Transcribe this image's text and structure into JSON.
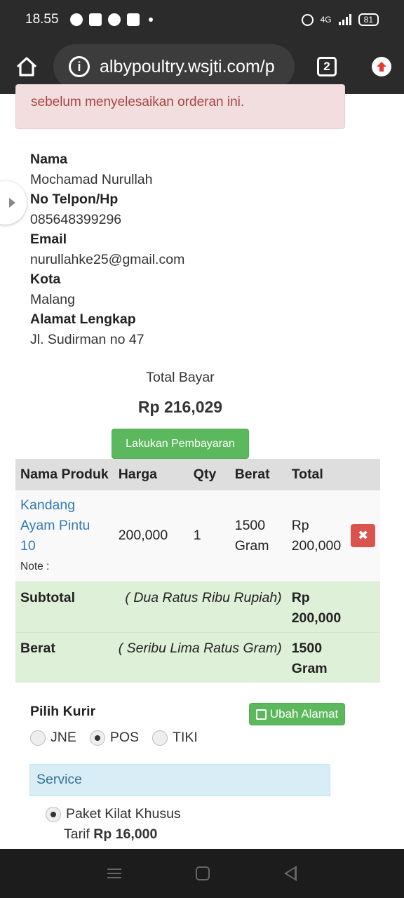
{
  "statusbar": {
    "time": "18.55",
    "network": "4G",
    "battery": "81"
  },
  "browser": {
    "url": "albypoultry.wsjti.com/p",
    "tab_count": "2"
  },
  "alert": {
    "text": "sebelum menyelesaikan orderan ini."
  },
  "customer": {
    "name_label": "Nama",
    "name": "Mochamad Nurullah",
    "phone_label": "No Telpon/Hp",
    "phone": "085648399296",
    "email_label": "Email",
    "email": "nurullahke25@gmail.com",
    "city_label": "Kota",
    "city": "Malang",
    "address_label": "Alamat Lengkap",
    "address": "Jl. Sudirman no 47"
  },
  "payment": {
    "total_label": "Total Bayar",
    "total_value": "Rp 216,029",
    "pay_button": "Lakukan Pembayaran"
  },
  "cart": {
    "headers": [
      "Nama Produk",
      "Harga",
      "Qty",
      "Berat",
      "Total"
    ],
    "item": {
      "name_line1": "Kandang",
      "name_line2": "Ayam Pintu",
      "name_line3": "10",
      "note": "Note :",
      "price": "200,000",
      "qty": "1",
      "weight_line1": "1500",
      "weight_line2": "Gram",
      "total_line1": "Rp",
      "total_line2": "200,000",
      "delete_icon": "times-icon"
    },
    "subtotal": {
      "label": "Subtotal",
      "words": "( Dua Ratus Ribu Rupiah)",
      "value_line1": "Rp",
      "value_line2": "200,000"
    },
    "weight": {
      "label": "Berat",
      "words": "( Seribu Lima Ratus Gram)",
      "value_line1": "1500",
      "value_line2": "Gram"
    }
  },
  "courier": {
    "label": "Pilih Kurir",
    "change_address_button": "Ubah Alamat",
    "options": [
      "JNE",
      "POS",
      "TIKI"
    ],
    "selected": "POS"
  },
  "service": {
    "header": "Service",
    "option_name": "Paket Kilat Khusus",
    "tarif_label": "Tarif",
    "tarif_value": "Rp 16,000"
  },
  "colors": {
    "success": "#5cb85c",
    "danger": "#d9534f",
    "link": "#337ab7",
    "info_bg": "#d9edf7"
  }
}
